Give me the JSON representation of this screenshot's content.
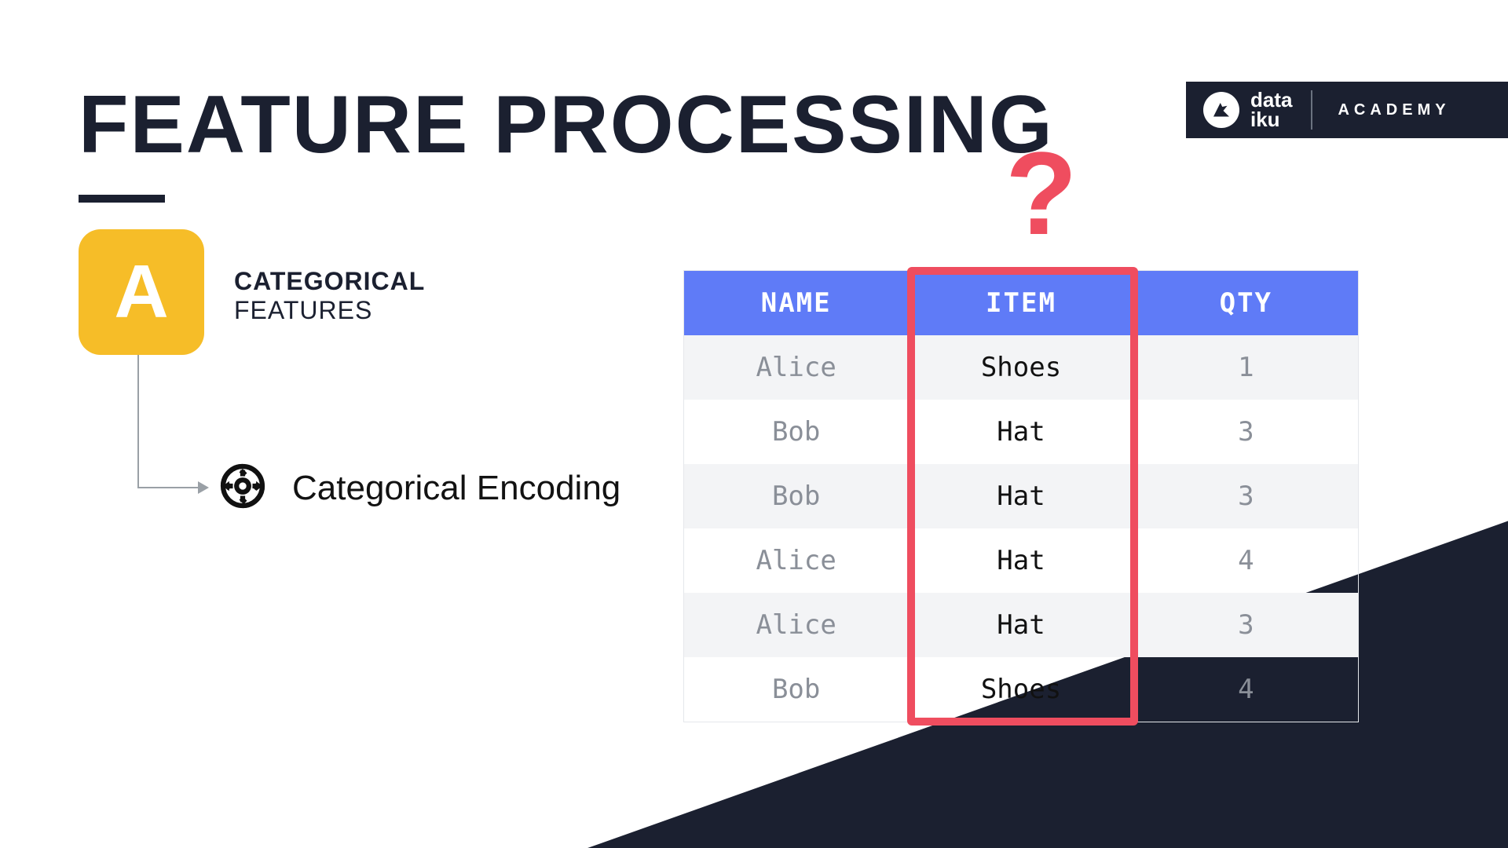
{
  "title": "FEATURE PROCESSING",
  "logo": {
    "line1": "data",
    "line2": "iku",
    "academy": "ACADEMY"
  },
  "badge_letter": "A",
  "categorical": {
    "bold": "CATEGORICAL",
    "light": "FEATURES"
  },
  "encoding_label": "Categorical Encoding",
  "question_mark": "?",
  "table": {
    "headers": [
      "NAME",
      "ITEM",
      "QTY"
    ],
    "rows": [
      {
        "name": "Alice",
        "item": "Shoes",
        "qty": "1"
      },
      {
        "name": "Bob",
        "item": "Hat",
        "qty": "3"
      },
      {
        "name": "Bob",
        "item": "Hat",
        "qty": "3"
      },
      {
        "name": "Alice",
        "item": "Hat",
        "qty": "4"
      },
      {
        "name": "Alice",
        "item": "Hat",
        "qty": "3"
      },
      {
        "name": "Bob",
        "item": "Shoes",
        "qty": "4"
      }
    ]
  }
}
